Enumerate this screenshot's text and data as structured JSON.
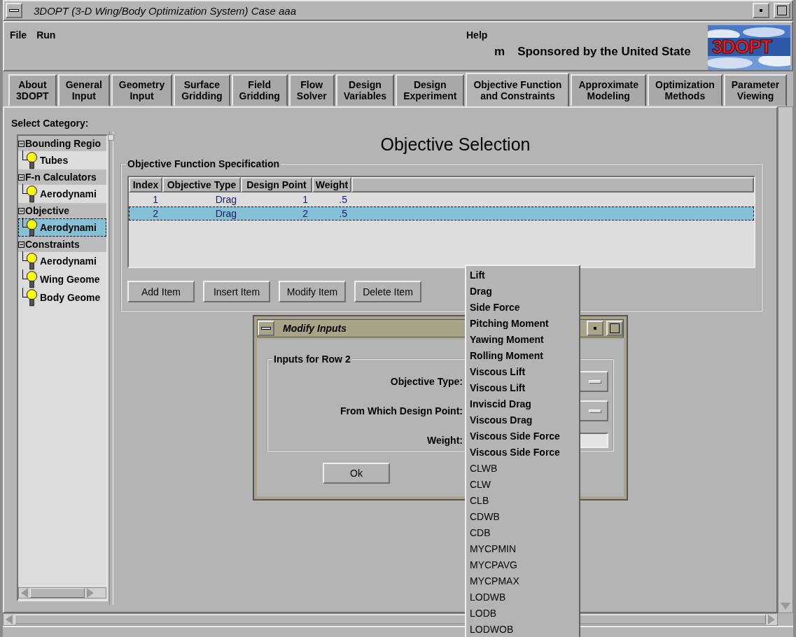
{
  "window": {
    "title": "3DOPT (3-D Wing/Body Optimization System) Case aaa"
  },
  "menu": [
    "File",
    "Run"
  ],
  "help_menu": "Help",
  "banner": {
    "mark": "m",
    "text": "Sponsored by the United State",
    "logo": "3DOPT"
  },
  "tabs": [
    {
      "lines": [
        "About",
        "3DOPT"
      ],
      "selected": false
    },
    {
      "lines": [
        "General",
        "Input"
      ],
      "selected": false
    },
    {
      "lines": [
        "Geometry",
        "Input"
      ],
      "selected": false
    },
    {
      "lines": [
        "Surface",
        "Gridding"
      ],
      "selected": false
    },
    {
      "lines": [
        "Field",
        "Gridding"
      ],
      "selected": false
    },
    {
      "lines": [
        "Flow",
        "Solver"
      ],
      "selected": false
    },
    {
      "lines": [
        "Design",
        "Variables"
      ],
      "selected": false
    },
    {
      "lines": [
        "Design",
        "Experiment"
      ],
      "selected": false
    },
    {
      "lines": [
        "Objective Function",
        "and Constraints"
      ],
      "selected": true
    },
    {
      "lines": [
        "Approximate",
        "Modeling"
      ],
      "selected": false
    },
    {
      "lines": [
        "Optimization",
        "Methods"
      ],
      "selected": false
    },
    {
      "lines": [
        "Parameter",
        "Viewing"
      ],
      "selected": false
    }
  ],
  "category_label": "Select Category:",
  "tree": [
    {
      "label": "Bounding Regio",
      "expanded": true,
      "children": [
        {
          "label": "Tubes",
          "selected": false
        }
      ]
    },
    {
      "label": "F-n Calculators",
      "expanded": true,
      "children": [
        {
          "label": "Aerodynami",
          "selected": false
        }
      ]
    },
    {
      "label": "Objective",
      "expanded": true,
      "children": [
        {
          "label": "Aerodynami",
          "selected": true
        }
      ]
    },
    {
      "label": "Constraints",
      "expanded": true,
      "children": [
        {
          "label": "Aerodynami",
          "selected": false
        },
        {
          "label": "Wing Geome",
          "selected": false
        },
        {
          "label": "Body Geome",
          "selected": false
        }
      ]
    }
  ],
  "page_title": "Objective Selection",
  "spec": {
    "title": "Objective Function Specification",
    "columns": [
      "Index",
      "Objective Type",
      "Design Point",
      "Weight"
    ],
    "rows": [
      {
        "cells": [
          "1",
          "Drag",
          "1",
          ".5"
        ],
        "selected": false
      },
      {
        "cells": [
          "2",
          "Drag",
          "2",
          ".5"
        ],
        "selected": true
      }
    ],
    "buttons": [
      "Add Item",
      "Insert Item",
      "Modify Item",
      "Delete Item"
    ]
  },
  "dialog": {
    "title": "Modify Inputs",
    "group_title": "Inputs for Row 2",
    "fields": [
      {
        "label": "Objective Type:",
        "kind": "dropdown"
      },
      {
        "label": "From Which Design Point:",
        "kind": "dropdown"
      },
      {
        "label": "Weight:",
        "kind": "text"
      }
    ],
    "buttons": [
      "Ok"
    ]
  },
  "dropdown": [
    {
      "label": "Lift",
      "kind": "named"
    },
    {
      "label": "Drag",
      "kind": "named"
    },
    {
      "label": "Side Force",
      "kind": "named"
    },
    {
      "label": "Pitching Moment",
      "kind": "named"
    },
    {
      "label": "Yawing Moment",
      "kind": "named"
    },
    {
      "label": "Rolling Moment",
      "kind": "named"
    },
    {
      "label": "Viscous Lift",
      "kind": "named"
    },
    {
      "label": "Viscous Lift",
      "kind": "named"
    },
    {
      "label": "Inviscid Drag",
      "kind": "named"
    },
    {
      "label": "Viscous Drag",
      "kind": "named"
    },
    {
      "label": "Viscous Side Force",
      "kind": "named"
    },
    {
      "label": "Viscous Side Force",
      "kind": "named"
    },
    {
      "label": "CLWB",
      "kind": "code"
    },
    {
      "label": "CLW",
      "kind": "code"
    },
    {
      "label": "CLB",
      "kind": "code"
    },
    {
      "label": "CDWB",
      "kind": "code"
    },
    {
      "label": "CDB",
      "kind": "code"
    },
    {
      "label": "MYCPMIN",
      "kind": "code"
    },
    {
      "label": "MYCPAVG",
      "kind": "code"
    },
    {
      "label": "MYCPMAX",
      "kind": "code"
    },
    {
      "label": "LODWB",
      "kind": "code"
    },
    {
      "label": "LODB",
      "kind": "code"
    },
    {
      "label": "LODWOB",
      "kind": "code"
    }
  ]
}
